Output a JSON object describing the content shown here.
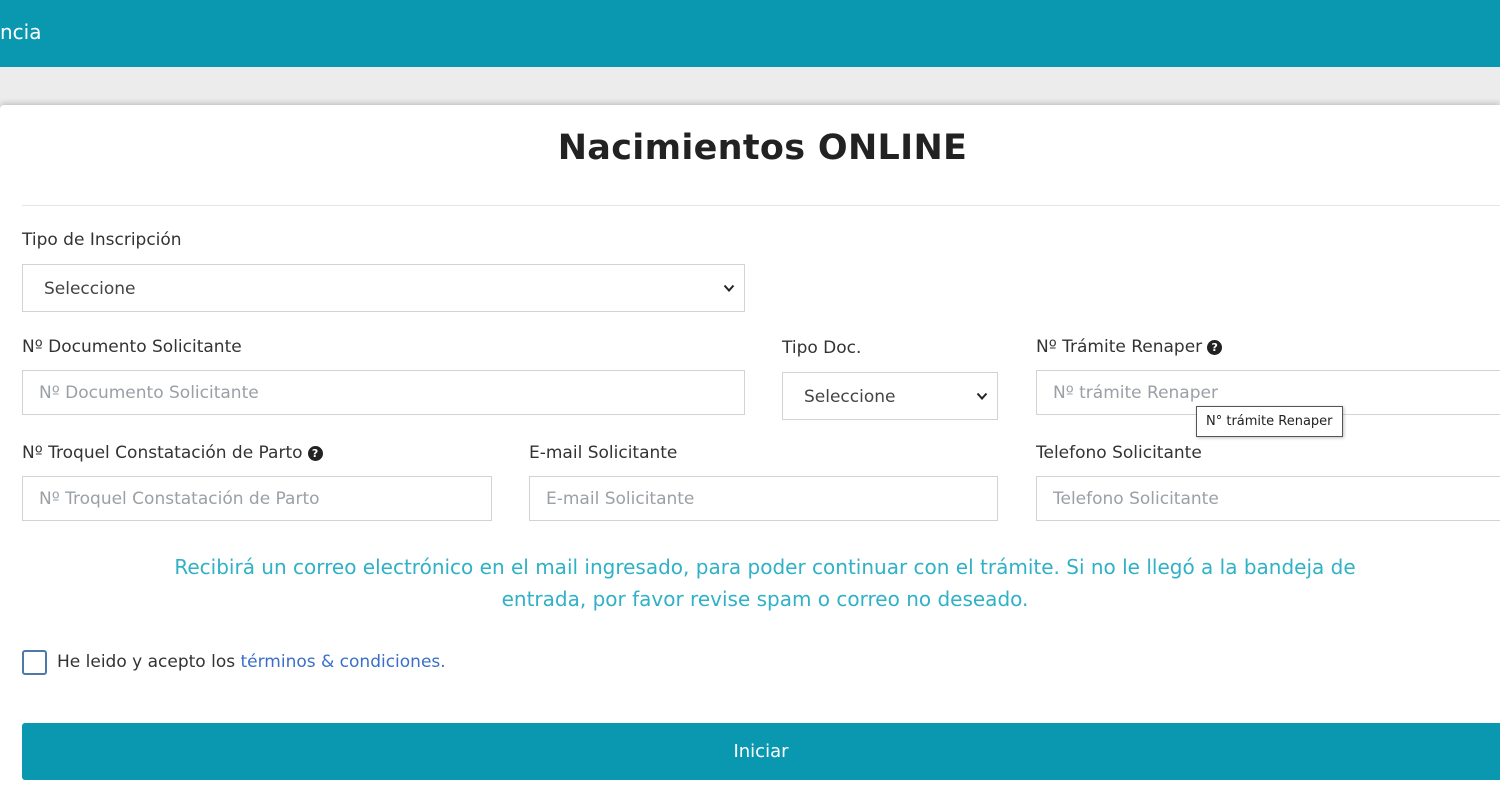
{
  "header": {
    "title_fragment": "ncia"
  },
  "page": {
    "title": "Nacimientos ONLINE"
  },
  "form": {
    "tipo_inscripcion": {
      "label": "Tipo de Inscripción",
      "selected": "Seleccione"
    },
    "documento": {
      "label": "Nº Documento Solicitante",
      "placeholder": "Nº Documento Solicitante",
      "value": ""
    },
    "tipo_doc": {
      "label": "Tipo Doc.",
      "selected": "Seleccione"
    },
    "tramite_renaper": {
      "label": "Nº Trámite Renaper",
      "help_icon": "question-circle-icon",
      "placeholder": "Nº trámite Renaper",
      "value": "",
      "tooltip": "N° trámite Renaper"
    },
    "troquel": {
      "label": "Nº Troquel Constatación de Parto",
      "help_icon": "question-circle-icon",
      "placeholder": "Nº Troquel Constatación de Parto",
      "value": ""
    },
    "email": {
      "label": "E-mail Solicitante",
      "placeholder": "E-mail Solicitante",
      "value": ""
    },
    "telefono": {
      "label": "Telefono Solicitante",
      "placeholder": "Telefono Solicitante",
      "value": ""
    },
    "info_message": "Recibirá un correo electrónico en el mail ingresado, para poder continuar con el trámite. Si no le llegó a la bandeja de entrada, por favor revise spam o correo no deseado.",
    "terms": {
      "checked": false,
      "prefix": "He leido y acepto los ",
      "link_text": "términos & condiciones."
    },
    "submit_label": "Iniciar"
  },
  "colors": {
    "primary": "#0a98b0",
    "info_text": "#2fb1c6",
    "link": "#3a6fc8",
    "checkbox_border": "#4b79a8"
  }
}
